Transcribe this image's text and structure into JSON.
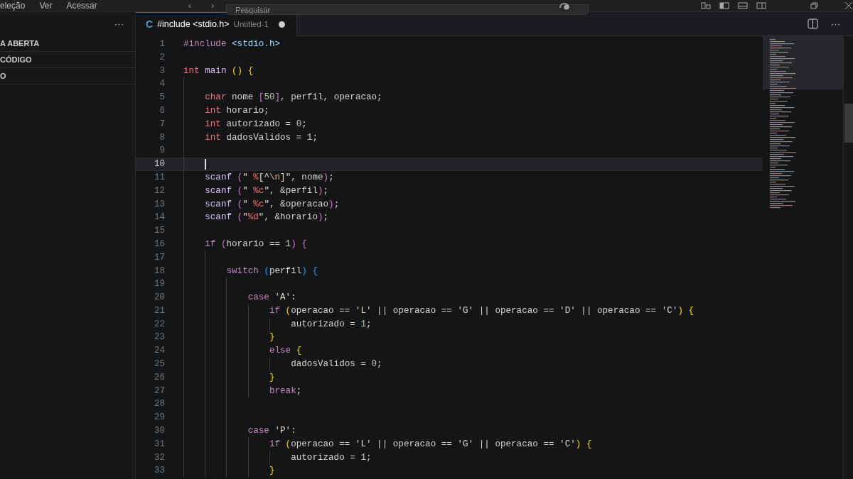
{
  "title_bar": {
    "menu": [
      "eleção",
      "Ver",
      "Acessar"
    ],
    "nav": [
      "‹",
      "›"
    ],
    "search": {
      "placeholder": "Pesquisar"
    }
  },
  "sidebar": {
    "more": "···",
    "sections": [
      "A ABERTA",
      "CÓDIGO",
      "O"
    ]
  },
  "tabs": [
    {
      "icon": "C",
      "label": "#include <stdio.h>",
      "detail": "Untitled-1",
      "modified": true,
      "selected": true
    }
  ],
  "editor_actions": {
    "more": "···"
  },
  "editor": {
    "lines": [
      {
        "number": "1",
        "current": false,
        "tokens": [
          {
            "kind": "preproc",
            "text": "#include "
          },
          {
            "kind": "header",
            "text": "<stdio.h>"
          }
        ]
      },
      {
        "number": "2",
        "current": false
      },
      {
        "number": "3",
        "current": false,
        "tokens": [
          {
            "kind": "type",
            "text": "int "
          },
          {
            "kind": "func",
            "text": "main "
          },
          {
            "kind": "bracket1",
            "text": "() "
          },
          {
            "kind": "bracket1",
            "text": "{"
          }
        ]
      },
      {
        "number": "4",
        "current": false
      },
      {
        "number": "5",
        "current": false,
        "tokens": [
          {
            "kind": "type",
            "text": "    char"
          },
          {
            "kind": "plain",
            "text": " nome "
          },
          {
            "kind": "bracket2",
            "text": "["
          },
          {
            "kind": "number",
            "text": "50"
          },
          {
            "kind": "bracket2",
            "text": "]"
          },
          {
            "kind": "plain",
            "text": ", perfil, operacao;"
          }
        ]
      },
      {
        "number": "6",
        "current": false,
        "tokens": [
          {
            "kind": "type",
            "text": "    int"
          },
          {
            "kind": "plain",
            "text": " horario;"
          }
        ]
      },
      {
        "number": "7",
        "current": false,
        "tokens": [
          {
            "kind": "type",
            "text": "    int"
          },
          {
            "kind": "plain",
            "text": " autorizado = "
          },
          {
            "kind": "number",
            "text": "0"
          },
          {
            "kind": "plain",
            "text": ";"
          }
        ]
      },
      {
        "number": "8",
        "current": false,
        "tokens": [
          {
            "kind": "type",
            "text": "    int"
          },
          {
            "kind": "plain",
            "text": " dadosValidos = "
          },
          {
            "kind": "number",
            "text": "1"
          },
          {
            "kind": "plain",
            "text": ";"
          }
        ]
      },
      {
        "number": "9",
        "current": false
      },
      {
        "number": "10",
        "current": true
      },
      {
        "number": "11",
        "current": false,
        "tokens": [
          {
            "kind": "func",
            "text": "    scanf "
          },
          {
            "kind": "bracket2",
            "text": "("
          },
          {
            "kind": "string",
            "text": "\" "
          },
          {
            "kind": "format",
            "text": "%"
          },
          {
            "kind": "string",
            "text": "[^"
          },
          {
            "kind": "escape",
            "text": "\\n"
          },
          {
            "kind": "string",
            "text": "]\""
          },
          {
            "kind": "plain",
            "text": ", nome"
          },
          {
            "kind": "bracket2",
            "text": ")"
          },
          {
            "kind": "plain",
            "text": ";"
          }
        ]
      },
      {
        "number": "12",
        "current": false,
        "tokens": [
          {
            "kind": "func",
            "text": "    scanf "
          },
          {
            "kind": "bracket2",
            "text": "("
          },
          {
            "kind": "string",
            "text": "\" "
          },
          {
            "kind": "format",
            "text": "%c"
          },
          {
            "kind": "string",
            "text": "\""
          },
          {
            "kind": "plain",
            "text": ", &perfil"
          },
          {
            "kind": "bracket2",
            "text": ")"
          },
          {
            "kind": "plain",
            "text": ";"
          }
        ]
      },
      {
        "number": "13",
        "current": false,
        "tokens": [
          {
            "kind": "func",
            "text": "    scanf "
          },
          {
            "kind": "bracket2",
            "text": "("
          },
          {
            "kind": "string",
            "text": "\" "
          },
          {
            "kind": "format",
            "text": "%c"
          },
          {
            "kind": "string",
            "text": "\""
          },
          {
            "kind": "plain",
            "text": ", &operacao"
          },
          {
            "kind": "bracket2",
            "text": ")"
          },
          {
            "kind": "plain",
            "text": ";"
          }
        ]
      },
      {
        "number": "14",
        "current": false,
        "tokens": [
          {
            "kind": "func",
            "text": "    scanf "
          },
          {
            "kind": "bracket2",
            "text": "("
          },
          {
            "kind": "string",
            "text": "\""
          },
          {
            "kind": "format",
            "text": "%d"
          },
          {
            "kind": "string",
            "text": "\""
          },
          {
            "kind": "plain",
            "text": ", &horario"
          },
          {
            "kind": "bracket2",
            "text": ")"
          },
          {
            "kind": "plain",
            "text": ";"
          }
        ]
      },
      {
        "number": "15",
        "current": false
      },
      {
        "number": "16",
        "current": false,
        "tokens": [
          {
            "kind": "control",
            "text": "    if "
          },
          {
            "kind": "bracket2",
            "text": "("
          },
          {
            "kind": "plain",
            "text": "horario == "
          },
          {
            "kind": "number",
            "text": "1"
          },
          {
            "kind": "bracket2",
            "text": ") "
          },
          {
            "kind": "bracket2",
            "text": "{"
          }
        ]
      },
      {
        "number": "17",
        "current": false
      },
      {
        "number": "18",
        "current": false,
        "tokens": [
          {
            "kind": "control",
            "text": "        switch "
          },
          {
            "kind": "bracket3",
            "text": "("
          },
          {
            "kind": "plain",
            "text": "perfil"
          },
          {
            "kind": "bracket3",
            "text": ") "
          },
          {
            "kind": "bracket3",
            "text": "{"
          }
        ]
      },
      {
        "number": "19",
        "current": false
      },
      {
        "number": "20",
        "current": false,
        "tokens": [
          {
            "kind": "control",
            "text": "            case "
          },
          {
            "kind": "string",
            "text": "'A'"
          },
          {
            "kind": "plain",
            "text": ":"
          }
        ]
      },
      {
        "number": "21",
        "current": false,
        "tokens": [
          {
            "kind": "control",
            "text": "                if "
          },
          {
            "kind": "bracket1",
            "text": "("
          },
          {
            "kind": "plain",
            "text": "operacao == "
          },
          {
            "kind": "string",
            "text": "'L'"
          },
          {
            "kind": "plain",
            "text": " || operacao == "
          },
          {
            "kind": "string",
            "text": "'G'"
          },
          {
            "kind": "plain",
            "text": " || operacao == "
          },
          {
            "kind": "string",
            "text": "'D'"
          },
          {
            "kind": "plain",
            "text": " || operacao == "
          },
          {
            "kind": "string",
            "text": "'C'"
          },
          {
            "kind": "bracket1",
            "text": ") "
          },
          {
            "kind": "bracket1",
            "text": "{"
          }
        ]
      },
      {
        "number": "22",
        "current": false,
        "tokens": [
          {
            "kind": "plain",
            "text": "                    autorizado = "
          },
          {
            "kind": "number",
            "text": "1"
          },
          {
            "kind": "plain",
            "text": ";"
          }
        ]
      },
      {
        "number": "23",
        "current": false,
        "tokens": [
          {
            "kind": "bracket1",
            "text": "                }"
          }
        ]
      },
      {
        "number": "24",
        "current": false,
        "tokens": [
          {
            "kind": "control",
            "text": "                else "
          },
          {
            "kind": "bracket1",
            "text": "{"
          }
        ]
      },
      {
        "number": "25",
        "current": false,
        "tokens": [
          {
            "kind": "plain",
            "text": "                    dadosValidos = "
          },
          {
            "kind": "number",
            "text": "0"
          },
          {
            "kind": "plain",
            "text": ";"
          }
        ]
      },
      {
        "number": "26",
        "current": false,
        "tokens": [
          {
            "kind": "bracket1",
            "text": "                }"
          }
        ]
      },
      {
        "number": "27",
        "current": false,
        "tokens": [
          {
            "kind": "control",
            "text": "                break"
          },
          {
            "kind": "plain",
            "text": ";"
          }
        ]
      },
      {
        "number": "28",
        "current": false
      },
      {
        "number": "29",
        "current": false
      },
      {
        "number": "30",
        "current": false,
        "tokens": [
          {
            "kind": "control",
            "text": "            case "
          },
          {
            "kind": "string",
            "text": "'P'"
          },
          {
            "kind": "plain",
            "text": ":"
          }
        ]
      },
      {
        "number": "31",
        "current": false,
        "tokens": [
          {
            "kind": "control",
            "text": "                if "
          },
          {
            "kind": "bracket1",
            "text": "("
          },
          {
            "kind": "plain",
            "text": "operacao == "
          },
          {
            "kind": "string",
            "text": "'L'"
          },
          {
            "kind": "plain",
            "text": " || operacao == "
          },
          {
            "kind": "string",
            "text": "'G'"
          },
          {
            "kind": "plain",
            "text": " || operacao == "
          },
          {
            "kind": "string",
            "text": "'C'"
          },
          {
            "kind": "bracket1",
            "text": ") "
          },
          {
            "kind": "bracket1",
            "text": "{"
          }
        ]
      },
      {
        "number": "32",
        "current": false,
        "tokens": [
          {
            "kind": "plain",
            "text": "                    autorizado = "
          },
          {
            "kind": "number",
            "text": "1"
          },
          {
            "kind": "plain",
            "text": ";"
          }
        ]
      },
      {
        "number": "33",
        "current": false,
        "tokens": [
          {
            "kind": "bracket1",
            "text": "                }"
          }
        ]
      }
    ]
  }
}
